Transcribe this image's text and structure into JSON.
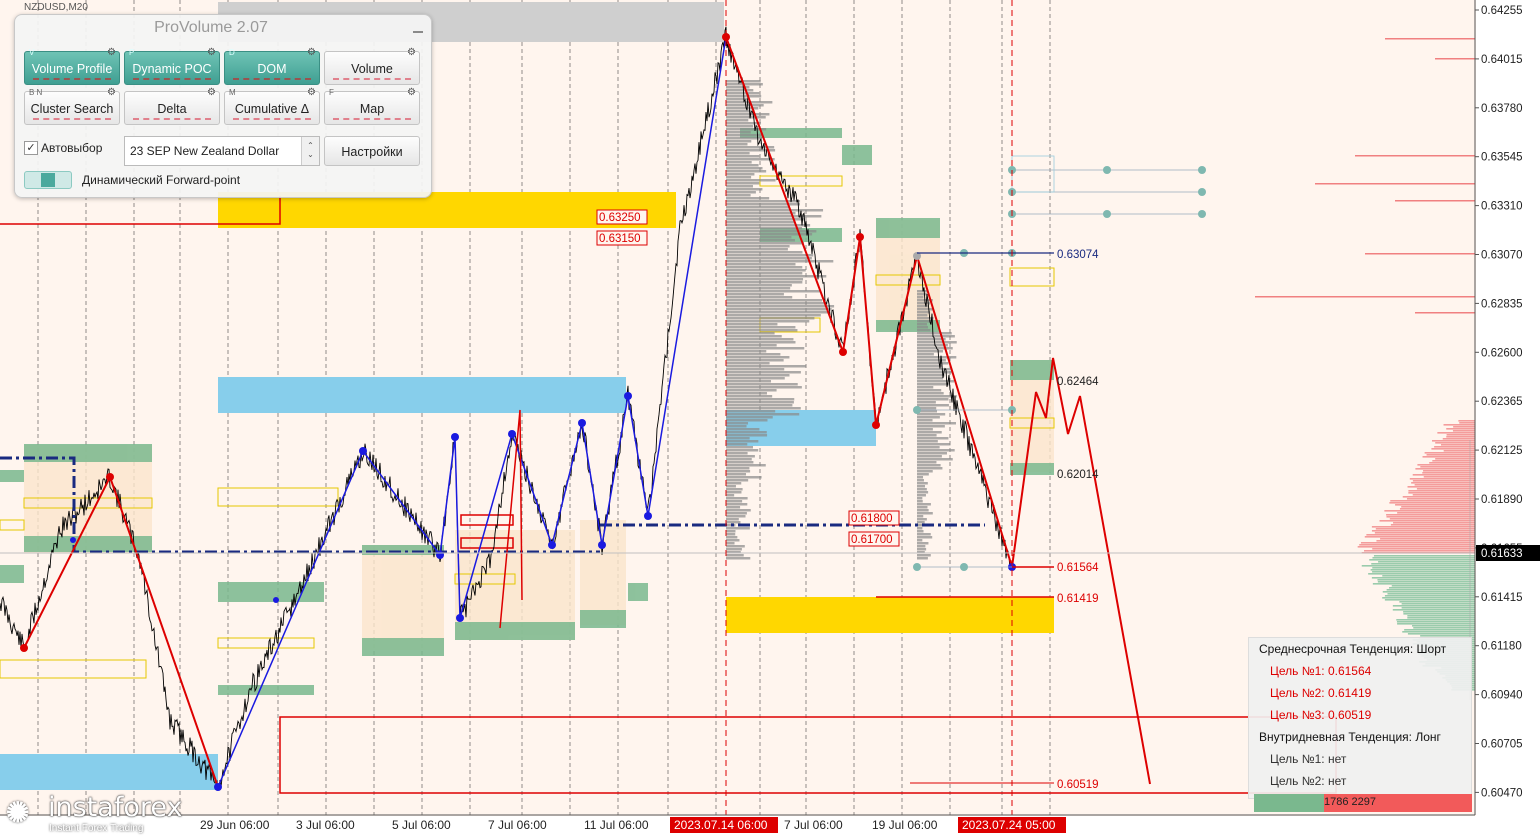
{
  "symbol": "NZDUSD,M20",
  "panel": {
    "title": "ProVolume 2.07",
    "buttons": [
      {
        "label": "Volume Profile",
        "hotkey": "V",
        "active": true
      },
      {
        "label": "Dynamic POC",
        "hotkey": "P",
        "active": true
      },
      {
        "label": "DOM",
        "hotkey": "D",
        "active": true
      },
      {
        "label": "Volume",
        "hotkey": "",
        "active": false
      },
      {
        "label": "Cluster Search",
        "hotkey": "B N",
        "active": false
      },
      {
        "label": "Delta",
        "hotkey": "",
        "active": false
      },
      {
        "label": "Cumulative Δ",
        "hotkey": "M",
        "active": false
      },
      {
        "label": "Map",
        "hotkey": "F",
        "active": false
      }
    ],
    "auto_select_label": "Автовыбор",
    "auto_select_checked": true,
    "instrument": "23 SEP New Zealand Dollar",
    "settings_label": "Настройки",
    "forward_point_label": "Динамический Forward-point"
  },
  "price_axis": {
    "ticks": [
      "0.64255",
      "0.64015",
      "0.63780",
      "0.63545",
      "0.63310",
      "0.63070",
      "0.62835",
      "0.62600",
      "0.62365",
      "0.62125",
      "0.61890",
      "0.61655",
      "0.61415",
      "0.61180",
      "0.60940",
      "0.60705",
      "0.60470"
    ],
    "current_price": "0.61633"
  },
  "time_axis": {
    "labels": [
      "29 Jun 06:00",
      "3 Jul 06:00",
      "5 Jul 06:00",
      "7 Jul 06:00",
      "11 Jul 06:00",
      "2023.07.14 06:00",
      "7 Jul 06:00",
      "19 Jul 06:00",
      "2023.07.24 05:00"
    ],
    "highlighted": [
      "2023.07.14 06:00",
      "2023.07.24 05:00"
    ]
  },
  "levels": [
    {
      "label": "0.63250",
      "boxed": true
    },
    {
      "label": "0.63150",
      "boxed": true
    },
    {
      "label": "0.63074",
      "boxed": false,
      "color": "#1a2a80"
    },
    {
      "label": "0.62464",
      "boxed": false,
      "color": "#222"
    },
    {
      "label": "0.62014",
      "boxed": false,
      "color": "#222"
    },
    {
      "label": "0.61800",
      "boxed": true
    },
    {
      "label": "0.61700",
      "boxed": true
    },
    {
      "label": "0.61564",
      "boxed": false,
      "color": "#dd0000"
    },
    {
      "label": "0.61419",
      "boxed": false,
      "color": "#dd0000"
    },
    {
      "label": "0.60519",
      "boxed": false,
      "color": "#dd0000"
    }
  ],
  "trend": {
    "medium_title": "Среднесрочная Тенденция: Шорт",
    "medium_targets": [
      "Цель №1: 0.61564",
      "Цель №2: 0.61419",
      "Цель №3: 0.60519"
    ],
    "intraday_title": "Внутридневная Тенденция: Лонг",
    "intraday_targets": [
      "Цель №1: нет",
      "Цель №2: нет"
    ]
  },
  "dom_counts": {
    "bid": "1786",
    "ask": "2297"
  },
  "logo": {
    "name": "instaforex",
    "tagline": "Instant Forex Trading"
  },
  "colors": {
    "background": "#fff5ee",
    "supply_zone": "#ffd700",
    "demand_zone": "#87ceeb",
    "volume_green": "#7ab88e",
    "zigzag_red": "#dd0000",
    "zigzag_blue": "#1a1ae0",
    "poc_line": "#1a2a80"
  }
}
